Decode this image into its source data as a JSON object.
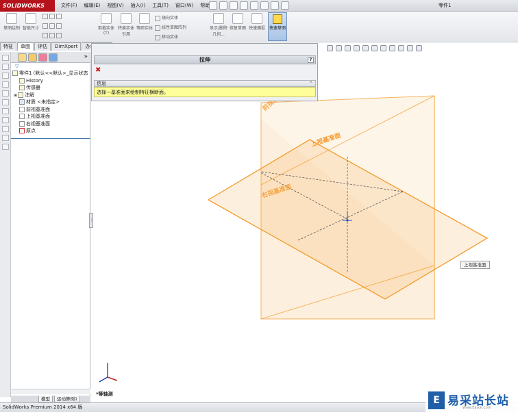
{
  "app": {
    "logo": "SOLIDWORKS",
    "doc_title": "零件1",
    "menu": [
      "文件(F)",
      "编辑(E)",
      "视图(V)",
      "插入(I)",
      "工具(T)",
      "窗口(W)",
      "帮助(H)"
    ]
  },
  "toolbar": {
    "sketch_label": "草图绘制",
    "smart_dim_label": "智能尺寸",
    "trim_label": "剪裁实体(T)",
    "convert_label": "转换实体引用",
    "offset_label": "等距实体",
    "mirror_label": "镜向实体",
    "linear_pattern_label": "线性草图阵列",
    "move_label": "移动实体",
    "display_relations_label": "显示/删除几何...",
    "repair_label": "修复草图",
    "rapid_sketch_label": "快速捕捉",
    "exit_sketch_label": "快速草图"
  },
  "tabs": [
    "特征",
    "草图",
    "评估",
    "DimXpert",
    "办公室产品"
  ],
  "feature_tree": {
    "root": "零件1 (默认<<默认>_显示状态",
    "items": [
      "History",
      "传感器",
      "注解",
      "材质 <未指定>",
      "前视基准面",
      "上视基准面",
      "右视基准面",
      "原点"
    ]
  },
  "bottom_tabs": [
    "模型",
    "运动算例1"
  ],
  "property_manager": {
    "title": "拉伸",
    "help": "?",
    "message_header": "信息",
    "message": "选择一基准面来绘制特征横断面。"
  },
  "viewport": {
    "plane_labels": [
      "前视基准面",
      "上视基准面",
      "右视基准面"
    ],
    "tooltip": "上视基准面",
    "view_name": "*等轴测",
    "plane_color": "#f39a2a"
  },
  "status": {
    "text": "SolidWorks Premium 2014 x64 版"
  },
  "watermark": {
    "mark": "E",
    "text": "易采站长站",
    "sub": "Www.Easck.Com"
  }
}
